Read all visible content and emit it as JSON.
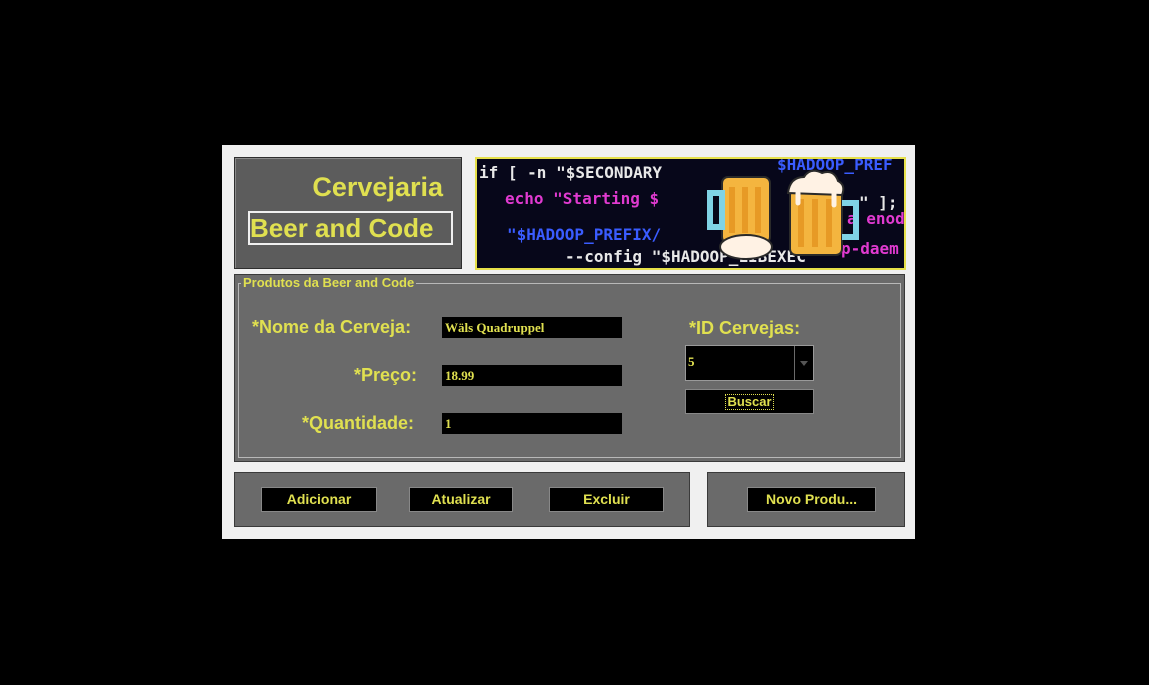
{
  "header": {
    "title_line1": "Cervejaria",
    "title_line2": "Beer and Code"
  },
  "banner": {
    "code_lines": [
      "if [ -n \"$SECONDARY",
      "echo \"Starting $",
      "\"$HADOOP_PREFIX/",
      "--config \"$HADOOP_LIBEXEC",
      "$HADOOP_PREF",
      "\" ];",
      "a enode",
      "p-daem"
    ],
    "icon": "beer-mugs-icon"
  },
  "form": {
    "legend": "Produtos da Beer and Code",
    "nome_label": "*Nome da Cerveja:",
    "nome_value": "Wäls Quadruppel",
    "preco_label": "*Preço:",
    "preco_value": "18.99",
    "quantidade_label": "*Quantidade:",
    "quantidade_value": "1",
    "id_label": "*ID Cervejas:",
    "id_value": "5",
    "buscar_label": "Buscar"
  },
  "actions": {
    "adicionar": "Adicionar",
    "atualizar": "Atualizar",
    "excluir": "Excluir",
    "novo": "Novo Produ..."
  },
  "colors": {
    "background": "#000000",
    "window": "#f0f0f0",
    "panel": "#6a6a6a",
    "accent_text": "#e0e050",
    "banner_border": "#e6e04a"
  }
}
